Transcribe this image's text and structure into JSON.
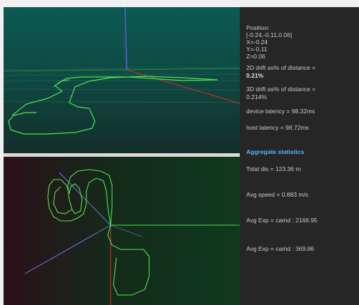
{
  "stats_panel": {
    "position_label": "Position:",
    "position_vector": "[-0.24,-0.11,0.06]",
    "x": "X=-0.24",
    "y": "Y=-0.11",
    "z": "Z=0.06",
    "drift_2d_label": "2D drift as% of distance =",
    "drift_2d_value": "0.21%",
    "drift_3d_label": "3D drift as% of distance =",
    "drift_3d_value": "0.214%",
    "device_latency": "device latency = 98.32ms",
    "host_latency": "host latency = 98.72ms"
  },
  "aggregate": {
    "title": "Aggregate statistics",
    "total_dis": "Total dis = 123.36 m",
    "avg_speed": "Avg speed = 0.883 m/s",
    "avg_exp_1": "Avg Exp = camd : 2166.95",
    "avg_exp_2": "Avg Exp = camd : 369.86"
  },
  "colors": {
    "trajectory": "#4fe34f",
    "x_axis": "#d92a2a",
    "y_axis": "#7a7aff",
    "aggregate_title": "#52b8ff",
    "panel_bg": "#262626"
  }
}
